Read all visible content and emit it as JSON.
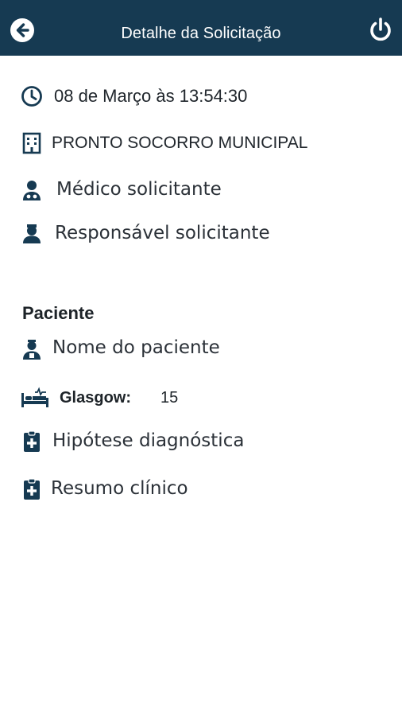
{
  "header": {
    "title": "Detalhe da Solicitação",
    "back_icon": "arrow-left-circle-icon",
    "power_icon": "power-icon",
    "background": "#163a52"
  },
  "request": {
    "datetime": "08 de Março às 13:54:30",
    "unit": "PRONTO SOCORRO MUNICIPAL",
    "requesting_doctor": "Médico solicitante",
    "requesting_responsible": "Responsável solicitante"
  },
  "patient": {
    "section_title": "Paciente",
    "name_placeholder": "Nome do paciente",
    "glasgow_label": "Glasgow:",
    "glasgow_value": "15",
    "diagnostic_hypothesis": "Hipótese diagnóstica",
    "clinical_summary": "Resumo clínico"
  },
  "colors": {
    "accent": "#163a52",
    "icon": "#163a52"
  }
}
